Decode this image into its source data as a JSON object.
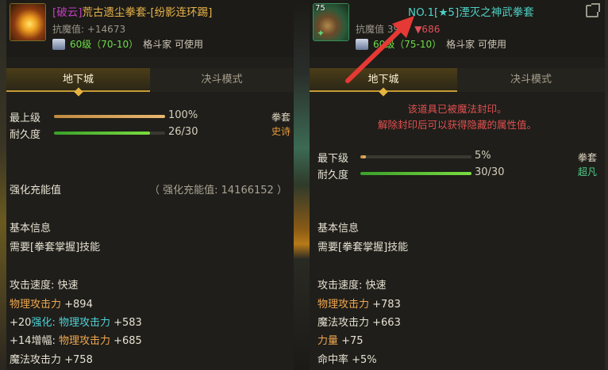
{
  "left": {
    "item_level": "",
    "tag": "[破云]",
    "name": "荒古遗尘拳套-[纷影连环踢]",
    "anti_magic_label": "抗魔值: ",
    "anti_magic_value": "+14673",
    "req_level": "60级（70-10）",
    "req_class": "格斗家 可使用",
    "tabs": [
      "地下城",
      "决斗模式"
    ],
    "grade_label": "最上级",
    "grade_value": "100%",
    "grade_fraction": 1.0,
    "durability_label": "耐久度",
    "durability_value": "26/30",
    "durability_fraction": 0.867,
    "category": "拳套",
    "rarity": "史诗",
    "enhance_label": "强化充能值",
    "enhance_value": "（ 强化充能值:  14166152 ）",
    "basic_info_title": "基本信息",
    "skill_req": "需要[拳套掌握]技能",
    "attack_speed": "攻击速度: 快速",
    "stats": [
      {
        "pre": "",
        "label": "物理攻击力",
        "value": " +894",
        "label_color": "orange"
      },
      {
        "pre": "+20",
        "label": "强化: ",
        "label2": "物理攻击力",
        "value": " +583",
        "label_color": "cyan"
      },
      {
        "pre": " +14",
        "label": "增幅: ",
        "label2": "物理攻击力",
        "value": " +685",
        "label_color": "plain"
      },
      {
        "pre": "",
        "label": "魔法攻击力",
        "value": " +758",
        "label_color": "plain"
      }
    ]
  },
  "right": {
    "item_level": "75",
    "title": "NO.1[★5]湮灭之神武拳套",
    "anti_magic_label": "抗魔值 ",
    "anti_magic_value": "3987",
    "anti_magic_delta": "▼686",
    "req_level": "60级（75-10）",
    "req_class": "格斗家 可使用",
    "tabs": [
      "地下城",
      "决斗模式"
    ],
    "seal_line1": "该道具已被魔法封印。",
    "seal_line2": "解除封印后可以获得隐藏的属性值。",
    "grade_label": "最下级",
    "grade_value": "5%",
    "grade_fraction": 0.05,
    "durability_label": "耐久度",
    "durability_value": "30/30",
    "durability_fraction": 1.0,
    "category": "拳套",
    "rarity": "超凡",
    "basic_info_title": "基本信息",
    "skill_req": "需要[拳套掌握]技能",
    "attack_speed": "攻击速度: 快速",
    "stats": [
      {
        "label": "物理攻击力",
        "value": " +783",
        "label_color": "orange"
      },
      {
        "label": "魔法攻击力",
        "value": " +663",
        "label_color": "plain"
      },
      {
        "label": "力量",
        "value": " +75",
        "label_color": "orange"
      },
      {
        "label": "命中率",
        "value": " +5%",
        "label_color": "plain"
      }
    ]
  },
  "colors": {
    "accent_gold": "#c79a32",
    "annotation_arrow": "#e53935",
    "seal_red": "#e05050",
    "rarity_epic": "#e89a3a",
    "rarity_transcendent": "#4fd18a"
  }
}
